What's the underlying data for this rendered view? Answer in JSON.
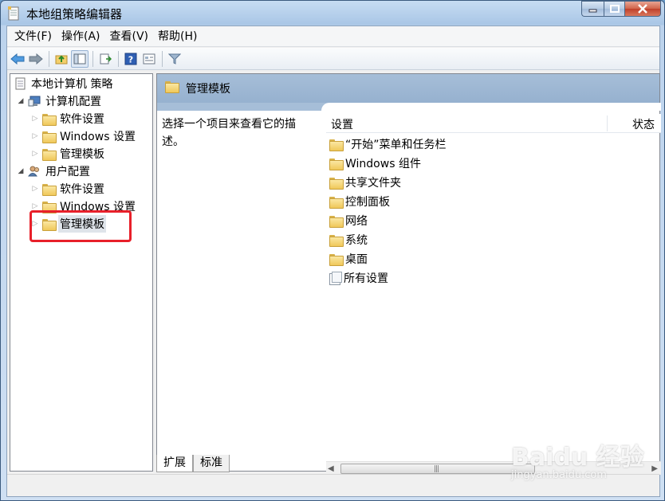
{
  "window": {
    "title": "本地组策略编辑器",
    "title_icon": "document-icon",
    "controls": [
      "minimize-icon",
      "maximize-icon",
      "close-icon"
    ]
  },
  "menubar": {
    "items": [
      "文件(F)",
      "操作(A)",
      "查看(V)",
      "帮助(H)"
    ]
  },
  "toolbar": {
    "buttons": [
      "back-arrow-icon",
      "forward-arrow-icon",
      "up-folder-icon",
      "show-hide-tree-icon",
      "export-list-icon",
      "help-icon",
      "properties-icon",
      "filter-icon"
    ]
  },
  "tree": {
    "root": "本地计算机 策略",
    "computer_config": {
      "label": "计算机配置",
      "children": [
        "软件设置",
        "Windows 设置",
        "管理模板"
      ]
    },
    "user_config": {
      "label": "用户配置",
      "children": [
        "软件设置",
        "Windows 设置",
        "管理模板"
      ]
    },
    "selected": "管理模板"
  },
  "right_pane": {
    "header": "管理模板",
    "description": "选择一个项目来查看它的描述。",
    "columns": [
      "设置",
      "状态"
    ],
    "items": [
      {
        "label": "“开始”菜单和任务栏",
        "icon": "folder-icon"
      },
      {
        "label": "Windows 组件",
        "icon": "folder-icon"
      },
      {
        "label": "共享文件夹",
        "icon": "folder-icon"
      },
      {
        "label": "控制面板",
        "icon": "folder-icon"
      },
      {
        "label": "网络",
        "icon": "folder-icon"
      },
      {
        "label": "系统",
        "icon": "folder-icon"
      },
      {
        "label": "桌面",
        "icon": "folder-icon"
      },
      {
        "label": "所有设置",
        "icon": "settings-page-icon"
      }
    ]
  },
  "tabs": {
    "items": [
      "扩展",
      "标准"
    ],
    "active": "扩展"
  },
  "watermark": {
    "brand": "Baidu 经验",
    "url": "jingyan.baidu.com"
  },
  "colors": {
    "highlight_box": "#e8202a",
    "header_band": "#a6bed8"
  }
}
